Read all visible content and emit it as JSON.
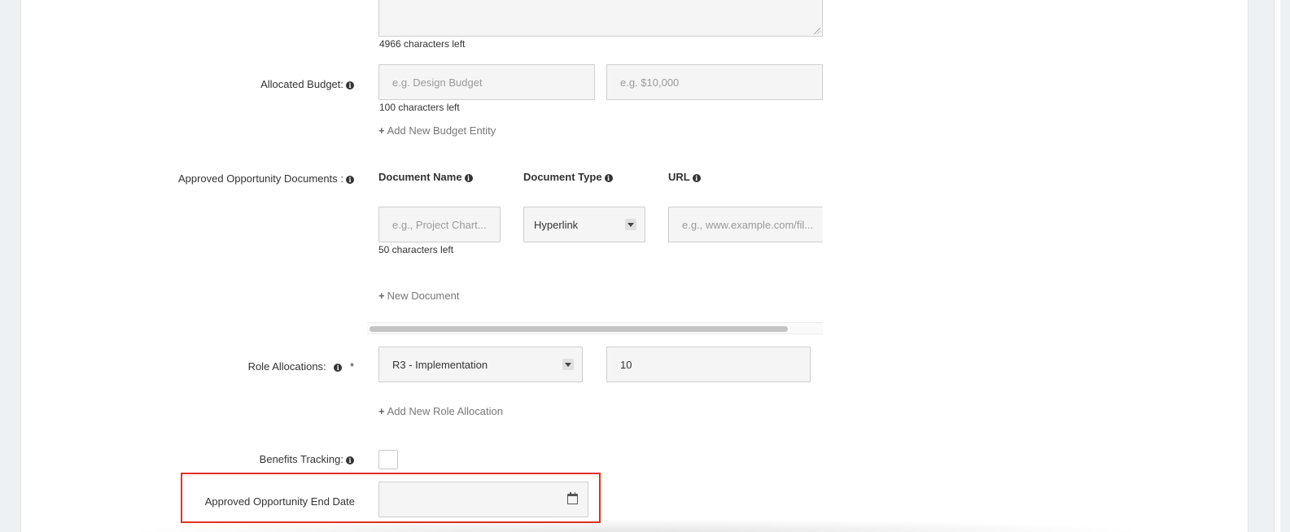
{
  "description_counter": "4966 characters left",
  "budget": {
    "label": "Allocated Budget:",
    "entity_placeholder": "e.g. Design Budget",
    "amount_placeholder": "e.g. $10,000",
    "counter": "100 characters left",
    "add_link": "Add New Budget Entity"
  },
  "documents": {
    "label": "Approved Opportunity Documents :",
    "col_name": "Document Name",
    "col_type": "Document Type",
    "col_url": "URL",
    "name_placeholder": "e.g., Project Chart...",
    "type_value": "Hyperlink",
    "url_placeholder": "e.g., www.example.com/fil...",
    "counter": "50 characters left",
    "add_link": "New Document"
  },
  "roles": {
    "label": "Role Allocations:",
    "required_mark": "*",
    "role_value": "R3 - Implementation",
    "count_value": "10",
    "add_link": "Add New Role Allocation"
  },
  "benefits": {
    "label": "Benefits Tracking:",
    "checked": false
  },
  "end_date": {
    "label": "Approved Opportunity End Date",
    "value": ""
  },
  "colors": {
    "highlight": "#e0321f",
    "input_bg": "#f5f5f5",
    "page_bg": "#eef1f3"
  },
  "icons": {
    "info": "info-circle-icon",
    "plus": "plus-icon",
    "calendar": "calendar-icon",
    "caret": "chevron-down-icon"
  }
}
